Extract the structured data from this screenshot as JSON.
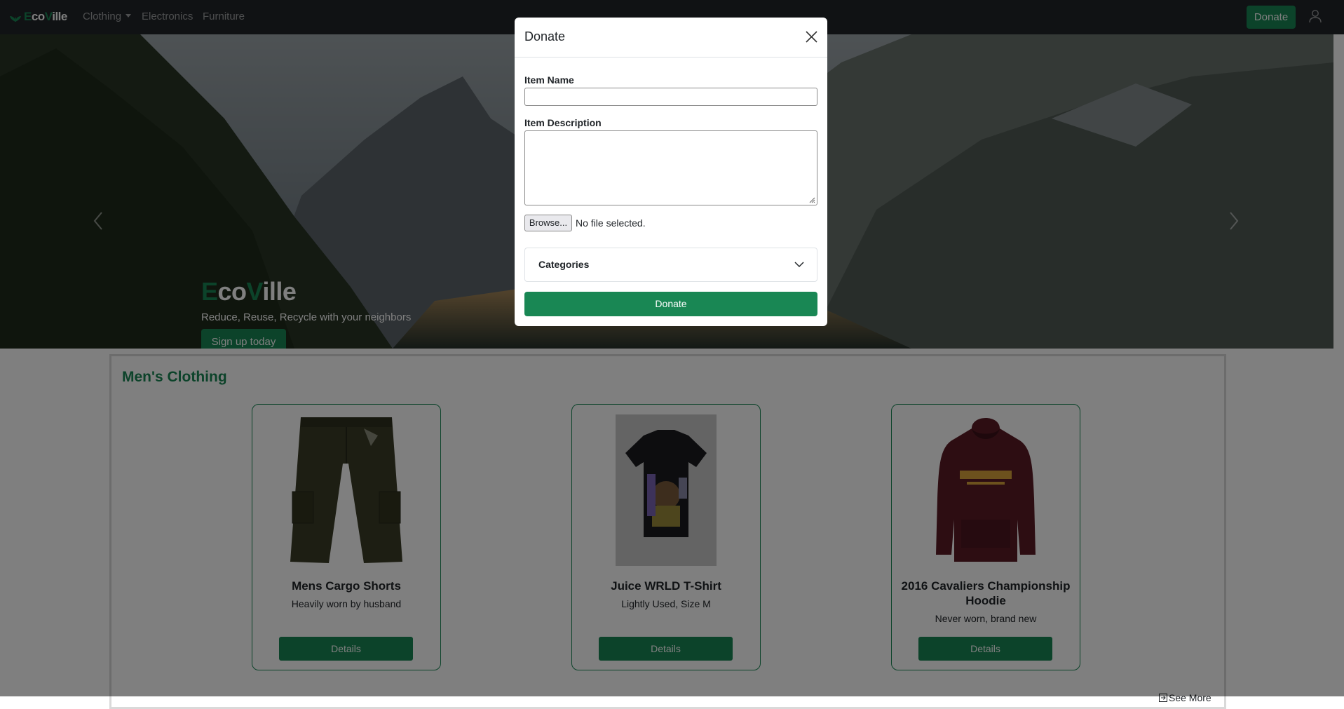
{
  "navbar": {
    "brand": {
      "e": "E",
      "co": "co",
      "v": "V",
      "ille": "ille"
    },
    "links": [
      {
        "label": "Clothing",
        "dropdown": true
      },
      {
        "label": "Electronics"
      },
      {
        "label": "Furniture"
      }
    ],
    "donate_label": "Donate",
    "user_icon": "user-icon"
  },
  "hero": {
    "title": {
      "e": "E",
      "co": "co",
      "v": "V",
      "ille": "ille"
    },
    "subtitle": "Reduce, Reuse, Recycle with your neighbors",
    "cta_label": "Sign up today"
  },
  "section": {
    "title": "Men's Clothing",
    "cards": [
      {
        "title": "Mens Cargo Shorts",
        "description": "Heavily worn by husband",
        "button": "Details"
      },
      {
        "title": "Juice WRLD T-Shirt",
        "description": "Lightly Used, Size M",
        "button": "Details"
      },
      {
        "title": "2016 Cavaliers Championship Hoodie",
        "description": "Never worn, brand new",
        "button": "Details"
      }
    ],
    "see_more_label": "See More"
  },
  "modal": {
    "title": "Donate",
    "item_name_label": "Item Name",
    "item_name_value": "",
    "item_description_label": "Item Description",
    "item_description_value": "",
    "browse_label": "Browse...",
    "file_status": "No file selected.",
    "categories_label": "Categories",
    "submit_label": "Donate"
  },
  "colors": {
    "brand_green": "#198754",
    "navbar_bg": "#212529"
  }
}
